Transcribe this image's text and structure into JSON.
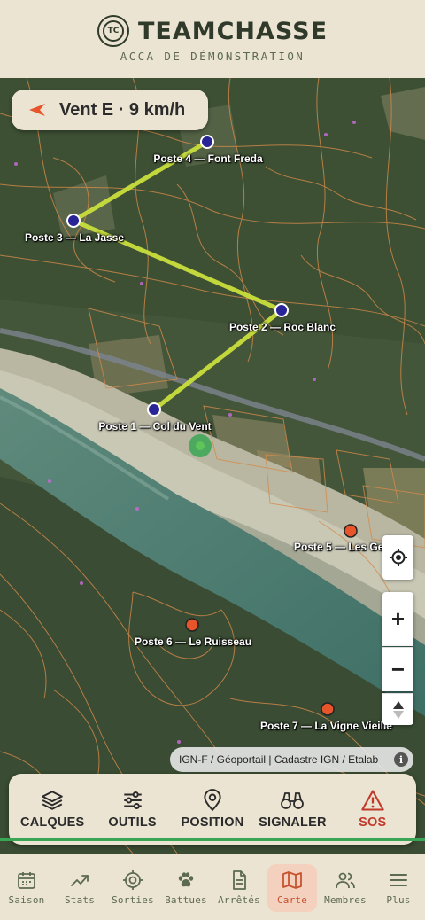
{
  "header": {
    "logo_text": "TC",
    "title": "TEAMCHASSE",
    "subtitle": "ACCA DE DÉMONSTRATION"
  },
  "map": {
    "wind": "Vent E · 9 km/h",
    "postes": [
      {
        "label": "Poste 4 — Font Freda"
      },
      {
        "label": "Poste 3 — La Jasse"
      },
      {
        "label": "Poste 2 — Roc Blanc"
      },
      {
        "label": "Poste 1 — Col du Vent"
      },
      {
        "label": "Poste 5 — Les Ge"
      },
      {
        "label": "Poste 6 — Le Ruisseau"
      },
      {
        "label": "Poste 7 — La Vigne Vieille"
      }
    ],
    "zoom_in": "+",
    "zoom_out": "−",
    "attribution": "IGN-F / Géoportail | Cadastre IGN / Etalab",
    "info_icon": "i"
  },
  "toolbar": {
    "calques": "CALQUES",
    "outils": "OUTILS",
    "position": "POSITION",
    "signaler": "SIGNALER",
    "sos": "SOS"
  },
  "nav": {
    "saison": "Saison",
    "stats": "Stats",
    "sorties": "Sorties",
    "battues": "Battues",
    "arretes": "Arrêtés",
    "carte": "Carte",
    "membres": "Membres",
    "plus": "Plus"
  },
  "colors": {
    "accent": "#c6532f",
    "sos": "#c0392b",
    "route": "#c8de3c",
    "poste_blue": "#2a2596",
    "poste_orange": "#e8552a",
    "position_green": "#3aa655"
  }
}
